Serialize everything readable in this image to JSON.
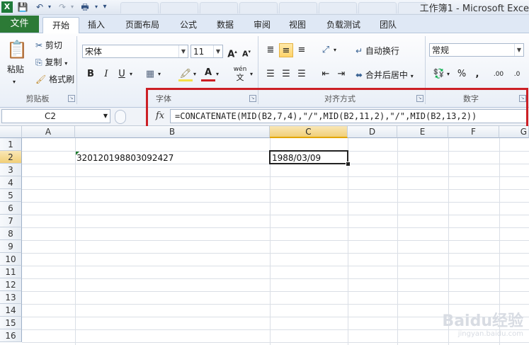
{
  "app": {
    "title": "工作簿1 - Microsoft Exce",
    "icon": "excel-logo-icon"
  },
  "quick_access": [
    "save-icon",
    "undo-icon",
    "redo-icon",
    "print-preview-icon",
    "customize-icon"
  ],
  "ribbon": {
    "file_tab": "文件",
    "tabs": [
      "开始",
      "插入",
      "页面布局",
      "公式",
      "数据",
      "审阅",
      "视图",
      "负载测试",
      "团队"
    ],
    "active_tab": "开始",
    "clipboard": {
      "paste": "粘贴",
      "cut": "剪切",
      "copy": "复制",
      "format_painter": "格式刷",
      "group_label": "剪贴板"
    },
    "font": {
      "name": "宋体",
      "size": "11",
      "grow": "A",
      "shrink": "A",
      "bold": "B",
      "italic": "I",
      "underline": "U",
      "font_color_letter": "A",
      "phonetic": "wén",
      "phonetic_sub": "文",
      "group_label": "字体"
    },
    "alignment": {
      "wrap_text": "自动换行",
      "merge_center": "合并后居中",
      "group_label": "对齐方式"
    },
    "number": {
      "format": "常规",
      "percent": "%",
      "comma": ",",
      "increase_decimal": ".00",
      "decrease_decimal": ".0",
      "group_label": "数字"
    }
  },
  "formula_bar": {
    "name_box": "C2",
    "fx": "fx",
    "formula": "=CONCATENATE(MID(B2,7,4),\"/\",MID(B2,11,2),\"/\",MID(B2,13,2))"
  },
  "sheet": {
    "columns": [
      "A",
      "B",
      "C",
      "D",
      "E",
      "F",
      "G"
    ],
    "rows": [
      "1",
      "2",
      "3",
      "4",
      "5",
      "6",
      "7",
      "8",
      "9",
      "10",
      "11",
      "12",
      "13",
      "14",
      "15",
      "16"
    ],
    "cells": {
      "B2": "320120198803092427",
      "C2": "1988/03/09"
    },
    "active_cell": "C2"
  },
  "watermark": {
    "brand": "Baidu经验",
    "url": "jingyan.baidu.com"
  },
  "colors": {
    "file_tab": "#2c7a36",
    "highlight_box": "#cc1f25",
    "selected_header": "#f1cf77"
  }
}
